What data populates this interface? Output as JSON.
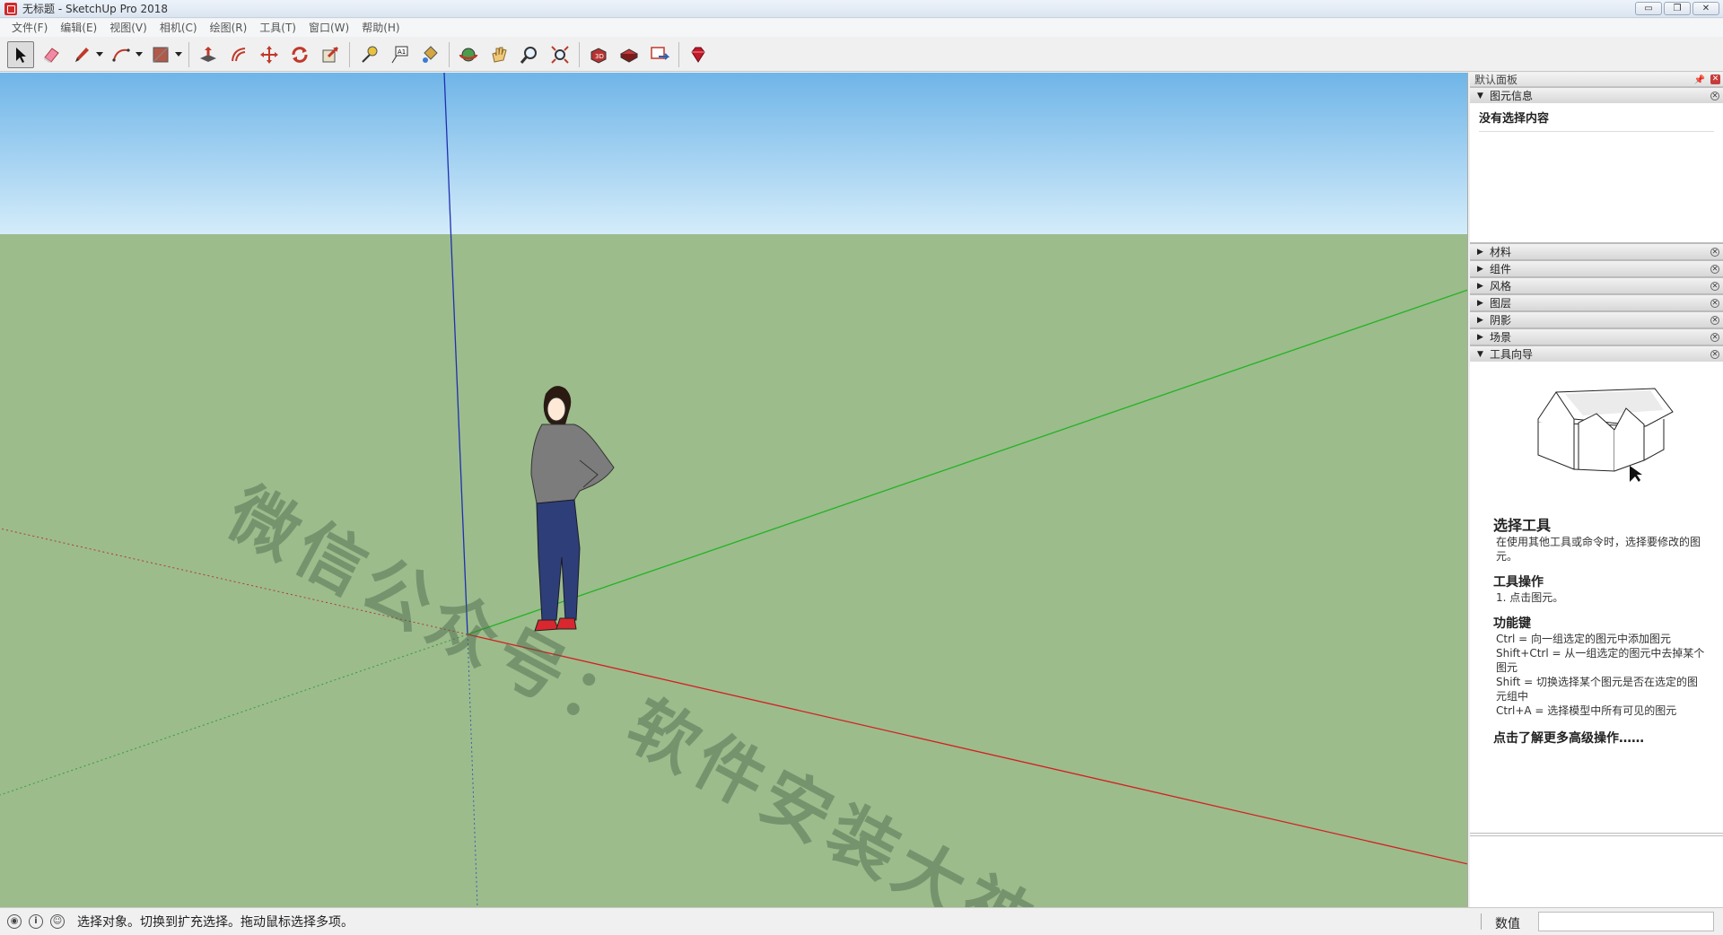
{
  "window": {
    "title": "无标题 - SketchUp Pro 2018",
    "controls": [
      "▭",
      "❐",
      "✕"
    ]
  },
  "menu": [
    "文件(F)",
    "编辑(E)",
    "视图(V)",
    "相机(C)",
    "绘图(R)",
    "工具(T)",
    "窗口(W)",
    "帮助(H)"
  ],
  "toolbar": {
    "tools": [
      "select-icon",
      "eraser-icon",
      "pencil-icon",
      "arc-icon",
      "shape-icon",
      "push-pull-icon",
      "offset-icon",
      "move-icon",
      "rotate-icon",
      "scale-icon",
      "tape-measure-icon",
      "text-icon",
      "paint-bucket-icon",
      "orbit-icon",
      "pan-icon",
      "zoom-icon",
      "zoom-extents-icon",
      "warehouse-icon",
      "extension-warehouse-icon",
      "send-to-layout-icon",
      "ruby-icon"
    ]
  },
  "viewport": {
    "watermark": "微信公众号：软件安装大神",
    "sky_color": "#87c6ef",
    "ground_color": "#9cbc8c"
  },
  "panel": {
    "title": "默认面板",
    "entity_info": {
      "label": "图元信息",
      "body": "没有选择内容"
    },
    "trays": [
      "材料",
      "组件",
      "风格",
      "图层",
      "阴影",
      "场景"
    ],
    "instructor": {
      "label": "工具向导",
      "title": "选择工具",
      "desc": "在使用其他工具或命令时，选择要修改的图元。",
      "ops_title": "工具操作",
      "ops": "1. 点击图元。",
      "keys_title": "功能键",
      "keys": [
        "Ctrl = 向一组选定的图元中添加图元",
        "Shift+Ctrl = 从一组选定的图元中去掉某个图元",
        "Shift = 切换选择某个图元是否在选定的图元组中",
        "Ctrl+A = 选择模型中所有可见的图元"
      ],
      "more": "点击了解更多高级操作……"
    }
  },
  "status": {
    "text": "选择对象。切换到扩充选择。拖动鼠标选择多项。",
    "vcb_label": "数值",
    "vcb_value": ""
  }
}
